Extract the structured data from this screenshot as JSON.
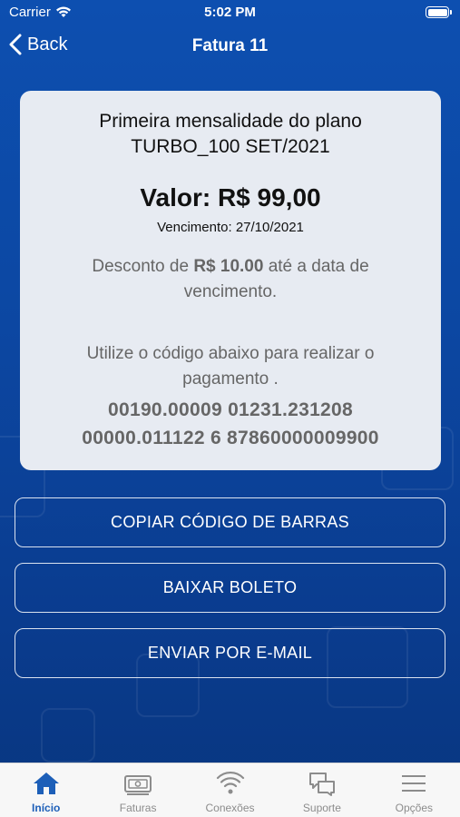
{
  "status_bar": {
    "carrier": "Carrier",
    "time": "5:02 PM"
  },
  "nav": {
    "back_label": "Back",
    "title": "Fatura 11"
  },
  "invoice": {
    "title_line1": "Primeira mensalidade do plano",
    "title_line2": "TURBO_100 SET/2021",
    "amount": "Valor: R$ 99,00",
    "due": "Vencimento: 27/10/2021",
    "discount_prefix": "Desconto de ",
    "discount_value": "R$ 10.00",
    "discount_suffix": " até a data de vencimento.",
    "instruction": "Utilize o código abaixo para realizar o pagamento .",
    "barcode_line1": "00190.00009 01231.231208",
    "barcode_line2": "00000.011122 6 87860000009900"
  },
  "actions": {
    "copy_label": "COPIAR CÓDIGO DE BARRAS",
    "download_label": "BAIXAR BOLETO",
    "email_label": "ENVIAR POR E-MAIL"
  },
  "tabs": [
    {
      "label": "Início",
      "icon": "home-icon",
      "active": true
    },
    {
      "label": "Faturas",
      "icon": "bill-icon",
      "active": false
    },
    {
      "label": "Conexões",
      "icon": "wifi-icon",
      "active": false
    },
    {
      "label": "Suporte",
      "icon": "chat-icon",
      "active": false
    },
    {
      "label": "Opções",
      "icon": "menu-icon",
      "active": false
    }
  ],
  "colors": {
    "accent": "#1d5fb8",
    "background": "#0c47a2",
    "card": "#e7ebf2"
  }
}
